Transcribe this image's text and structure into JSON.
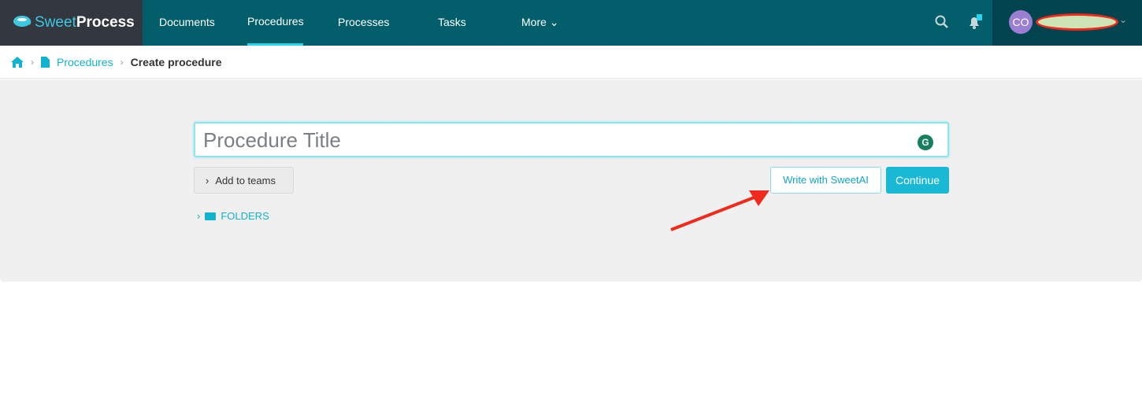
{
  "logo": {
    "part1": "Sweet",
    "part2": "Process"
  },
  "nav": {
    "items": [
      {
        "label": "Documents"
      },
      {
        "label": "Procedures"
      },
      {
        "label": "Processes"
      },
      {
        "label": "Tasks"
      },
      {
        "label": "More"
      }
    ],
    "active": "Procedures",
    "notification_count": "1"
  },
  "user": {
    "initials": "CO"
  },
  "breadcrumb": {
    "items": [
      "Procedures",
      "Create procedure"
    ]
  },
  "form": {
    "title_placeholder": "Procedure Title",
    "add_to_teams": "Add to teams",
    "folders": "FOLDERS",
    "write_ai": "Write with SweetAI",
    "continue": "Continue"
  },
  "colors": {
    "accent": "#19b8d4",
    "nav": "#025e6b",
    "annotation_arrow": "#f02a1c"
  }
}
